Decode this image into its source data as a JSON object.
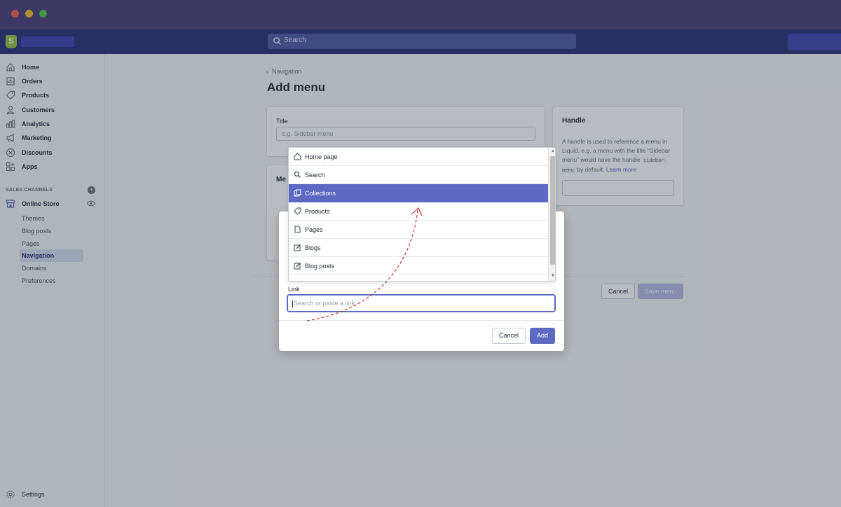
{
  "topbar": {
    "search_placeholder": "Search"
  },
  "sidebar": {
    "items": [
      {
        "label": "Home",
        "icon": "home-icon"
      },
      {
        "label": "Orders",
        "icon": "orders-icon"
      },
      {
        "label": "Products",
        "icon": "tag-icon"
      },
      {
        "label": "Customers",
        "icon": "person-icon"
      },
      {
        "label": "Analytics",
        "icon": "bar-chart-icon"
      },
      {
        "label": "Marketing",
        "icon": "megaphone-icon"
      },
      {
        "label": "Discounts",
        "icon": "discount-icon"
      },
      {
        "label": "Apps",
        "icon": "apps-icon"
      }
    ],
    "section_label": "SALES CHANNELS",
    "online_store": "Online Store",
    "sub_items": [
      {
        "label": "Themes"
      },
      {
        "label": "Blog posts"
      },
      {
        "label": "Pages"
      },
      {
        "label": "Navigation",
        "active": true
      },
      {
        "label": "Domains"
      },
      {
        "label": "Preferences"
      }
    ],
    "settings": "Settings"
  },
  "page": {
    "breadcrumb": "Navigation",
    "title": "Add menu",
    "title_field_label": "Title",
    "title_field_placeholder": "e.g. Sidebar menu",
    "menu_items_label": "Me",
    "handle": {
      "heading": "Handle",
      "text_before": "A handle is used to reference a menu in Liquid. e.g. a menu with the title “Sidebar menu” would have the handle ",
      "code": "sidebar-menu",
      "text_after": " by default. ",
      "link": "Learn more"
    },
    "cancel_label": "Cancel",
    "save_label": "Save menu"
  },
  "modal": {
    "link_label": "Link",
    "link_placeholder": "Search or paste a link",
    "cancel_label": "Cancel",
    "add_label": "Add"
  },
  "dropdown": {
    "options": [
      {
        "label": "Home page",
        "icon": "home-icon"
      },
      {
        "label": "Search",
        "icon": "search-icon"
      },
      {
        "label": "Collections",
        "icon": "collections-icon",
        "selected": true
      },
      {
        "label": "Products",
        "icon": "tag-icon"
      },
      {
        "label": "Pages",
        "icon": "page-icon"
      },
      {
        "label": "Blogs",
        "icon": "edit-icon"
      },
      {
        "label": "Blog posts",
        "icon": "edit-icon"
      }
    ]
  },
  "colors": {
    "accent": "#5c6ac4",
    "topbar": "#26307a",
    "window_bar": "#4a3c78",
    "annotation_arrow": "#c0392b"
  }
}
